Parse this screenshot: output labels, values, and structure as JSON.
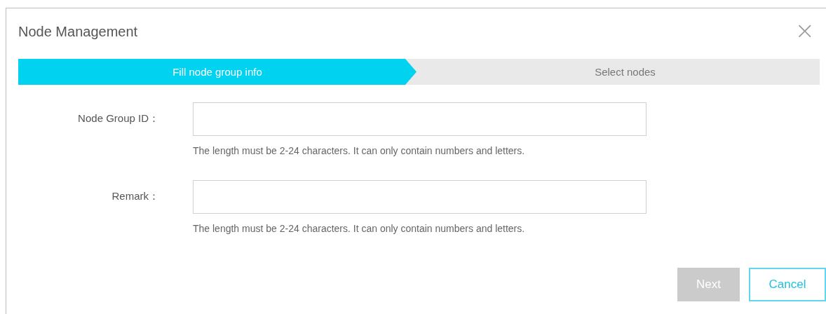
{
  "dialog": {
    "title": "Node Management",
    "close": "×"
  },
  "steps": [
    {
      "label": "Fill node group info",
      "selected": true
    },
    {
      "label": "Select nodes",
      "selected": false
    }
  ],
  "fields": [
    {
      "label": "Node Group ID：",
      "hint": "The length must be 2-24 characters. It can only contain numbers and letters."
    },
    {
      "label": "Remark：",
      "hint": "The length must be 2-24 characters. It can only contain numbers and letters."
    }
  ],
  "buttons": [
    {
      "label": "Next",
      "kind": "primary",
      "disabled": true
    },
    {
      "label": "Cancel",
      "kind": "secondary",
      "disabled": false
    }
  ]
}
